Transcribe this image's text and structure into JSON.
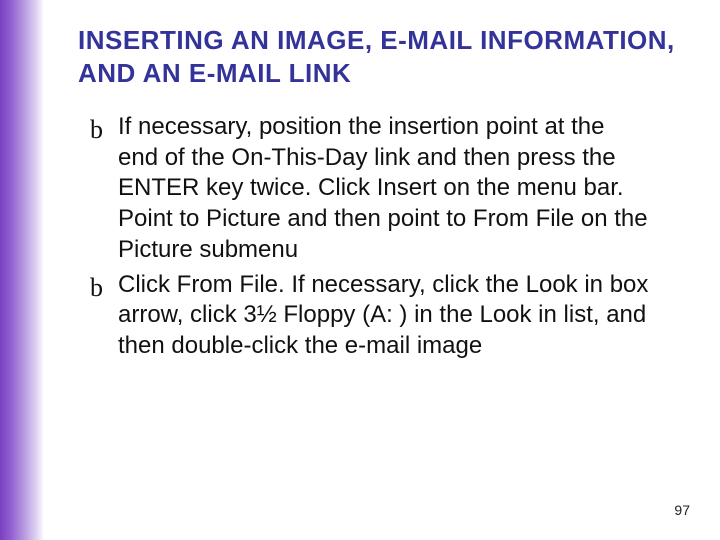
{
  "title": "INSERTING AN IMAGE, E-MAIL INFORMATION, AND AN E-MAIL LINK",
  "bullets": [
    {
      "glyph": "b",
      "text": "If necessary, position the insertion point at the end of the On-This-Day link and then press the ENTER key twice.  Click Insert on the menu bar.  Point to Picture and then point to From File on the Picture submenu"
    },
    {
      "glyph": "b",
      "text": "Click From File.  If necessary, click the Look in box arrow, click 3½  Floppy (A: ) in the Look in list, and then double-click the e-mail image"
    }
  ],
  "page_number": "97"
}
